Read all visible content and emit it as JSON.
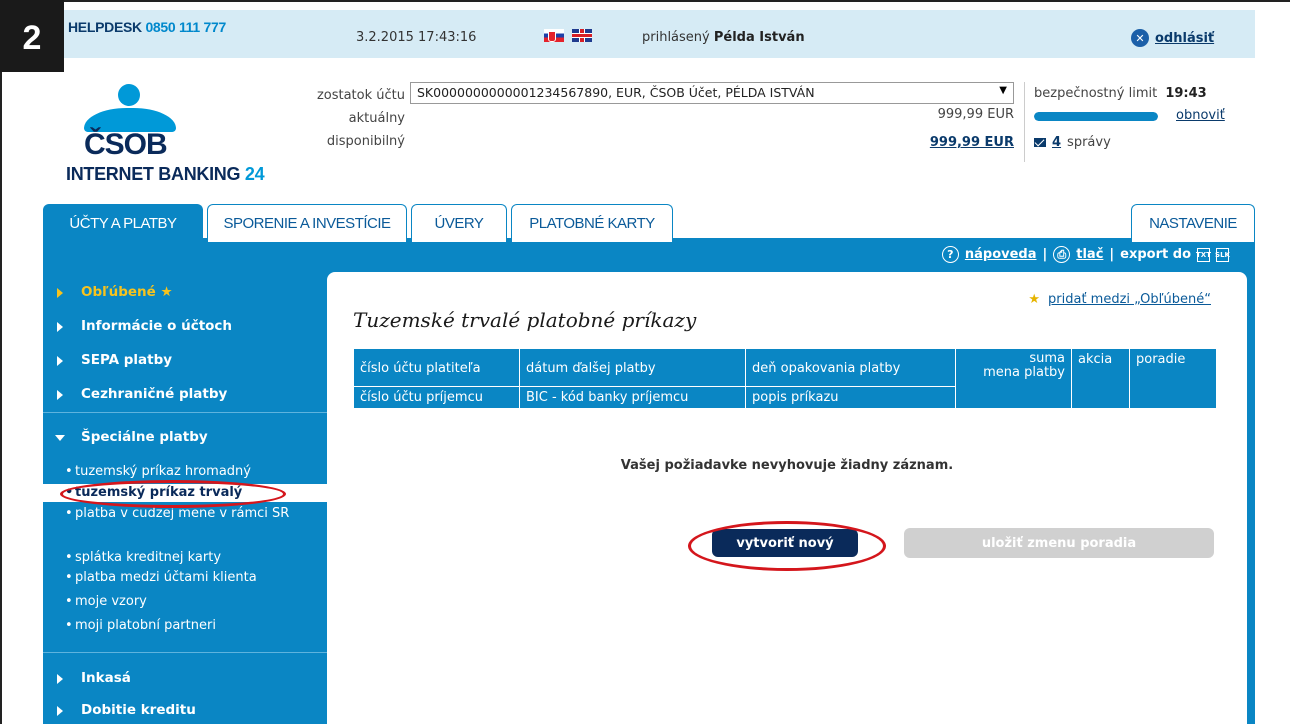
{
  "step_badge": "2",
  "header": {
    "helpdesk_label": "HELPDESK",
    "helpdesk_number": "0850 111 777",
    "datetime": "3.2.2015 17:43:16",
    "logged_prefix": "prihlásený",
    "logged_user": "Példa István",
    "logout": "odhlásiť"
  },
  "logo": {
    "name": "ČSOB",
    "sub": "INTERNET BANKING",
    "sub_num": "24"
  },
  "account": {
    "label_balance": "zostatok účtu",
    "label_actual": "aktuálny",
    "label_available": "disponibilný",
    "selected": "SK0000000000001234567890, EUR, ČSOB Účet, PÉLDA ISTVÁN",
    "actual_value": "999,99 EUR",
    "available_value": "999,99 EUR"
  },
  "security": {
    "label": "bezpečnostný limit",
    "time": "19:43",
    "progress_fraction": 1.0,
    "refresh": "obnoviť",
    "messages_count": "4",
    "messages_label": "správy"
  },
  "tabs": [
    {
      "label": "ÚČTY A PLATBY"
    },
    {
      "label": "SPORENIE A INVESTÍCIE"
    },
    {
      "label": "ÚVERY"
    },
    {
      "label": "PLATOBNÉ KARTY"
    },
    {
      "label": "NASTAVENIE"
    }
  ],
  "util": {
    "help": "nápoveda",
    "print": "tlač",
    "export": "export do",
    "txt": "TXT",
    "slk": "SLK"
  },
  "sidebar": {
    "favorites": "Obľúbené",
    "favorites_star": "★",
    "items": [
      "Informácie o účtoch",
      "SEPA platby",
      "Cezhraničné platby"
    ],
    "special": "Špeciálne platby",
    "sub": [
      "tuzemský príkaz hromadný",
      "tuzemský príkaz trvalý",
      "platba v cudzej mene v rámci SR",
      "splátka kreditnej karty",
      "platba medzi účtami klienta",
      "moje vzory",
      "moji platobní partneri"
    ],
    "after": [
      "Inkasá",
      "Dobitie kreditu"
    ]
  },
  "main": {
    "add_favorite": "pridať medzi „Obľúbené“",
    "title": "Tuzemské trvalé platobné príkazy",
    "columns_row1": [
      "číslo účtu platiteľa",
      "dátum ďalšej platby",
      "deň opakovania platby",
      "suma",
      "mena platby",
      "akcia",
      "poradie"
    ],
    "columns_row2": [
      "číslo účtu príjemcu",
      "BIC - kód banky príjemcu",
      "popis príkazu"
    ],
    "no_record": "Vašej požiadavke nevyhovuje žiadny záznam.",
    "btn_new": "vytvoriť nový",
    "btn_save_order": "uložiť zmenu poradia"
  }
}
